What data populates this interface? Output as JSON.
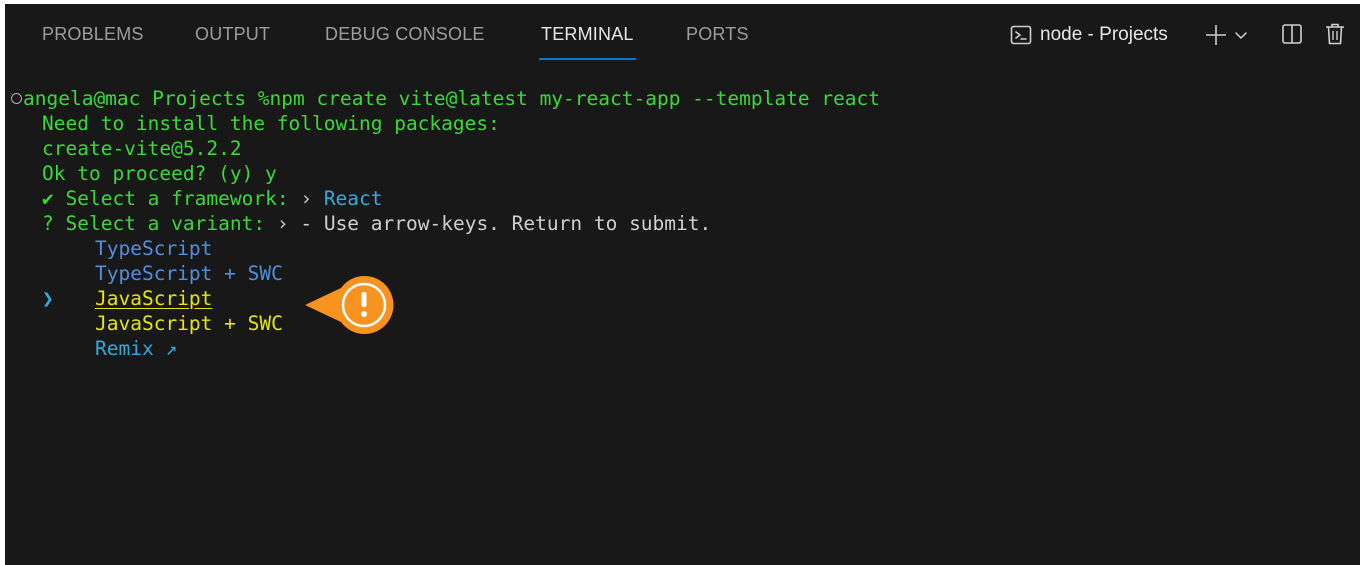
{
  "tabs": [
    {
      "label": "PROBLEMS"
    },
    {
      "label": "OUTPUT"
    },
    {
      "label": "DEBUG CONSOLE"
    },
    {
      "label": "TERMINAL",
      "active": true
    },
    {
      "label": "PORTS"
    }
  ],
  "terminal_selector": {
    "label": "node - Projects"
  },
  "icons": {
    "terminal": "terminal-icon",
    "add": "plus-icon",
    "dropdown": "chevron-down-icon",
    "split": "split-panel-icon",
    "delete": "trash-icon",
    "callout": "exclamation-icon"
  },
  "terminal": {
    "prompt_user": "angela@mac Projects %",
    "prompt_command": "npm create vite@latest my-react-app --template react",
    "line_install": "Need to install the following packages:",
    "line_package": "create-vite@5.2.2",
    "line_proceed": "Ok to proceed? (y) y",
    "framework_check": "✔",
    "framework_label": "Select a framework:",
    "framework_sep": "›",
    "framework_value": "React",
    "variant_q": "?",
    "variant_label": "Select a variant:",
    "variant_sep": "›",
    "variant_hint": "- Use arrow-keys. Return to submit.",
    "pointer": "❯",
    "options": [
      "TypeScript",
      "TypeScript + SWC",
      "JavaScript",
      "JavaScript + SWC",
      "Remix ↗"
    ]
  },
  "colors": {
    "panel_bg": "#181818",
    "accent": "#0078d4",
    "prompt_green": "#3ad93a",
    "option_blue": "#4f8fe0",
    "option_cyan": "#34a9dc",
    "selected_yellow": "#e5e510",
    "callout_orange": "#f7931e"
  }
}
